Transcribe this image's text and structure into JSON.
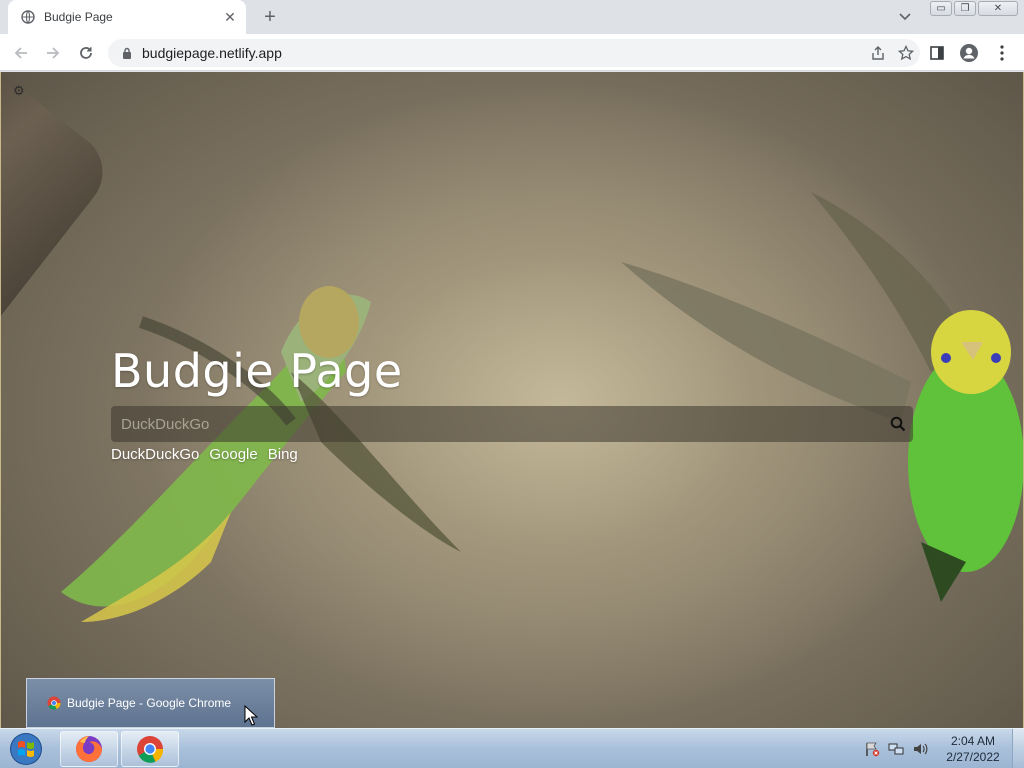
{
  "tab": {
    "title": "Budgie Page",
    "close": "✕",
    "new_tab": "+"
  },
  "window_controls": {
    "minimize": "▭",
    "restore": "❐",
    "close": "✕"
  },
  "address_bar": {
    "url": "budgiepage.netlify.app"
  },
  "page": {
    "heading": "Budgie Page",
    "settings_icon": "⚙",
    "search": {
      "placeholder": "DuckDuckGo",
      "value": ""
    },
    "engines": [
      "DuckDuckGo",
      "Google",
      "Bing"
    ]
  },
  "taskbar_preview": {
    "label": "Budgie Page - Google Chrome"
  },
  "taskbar": {
    "apps": [
      "Firefox",
      "Google Chrome"
    ],
    "clock": {
      "time": "2:04 AM",
      "date": "2/27/2022"
    }
  },
  "colors": {
    "tab_strip": "#dee1e6",
    "taskbar": "#a9c0da",
    "accent_green": "#6dc43a"
  }
}
